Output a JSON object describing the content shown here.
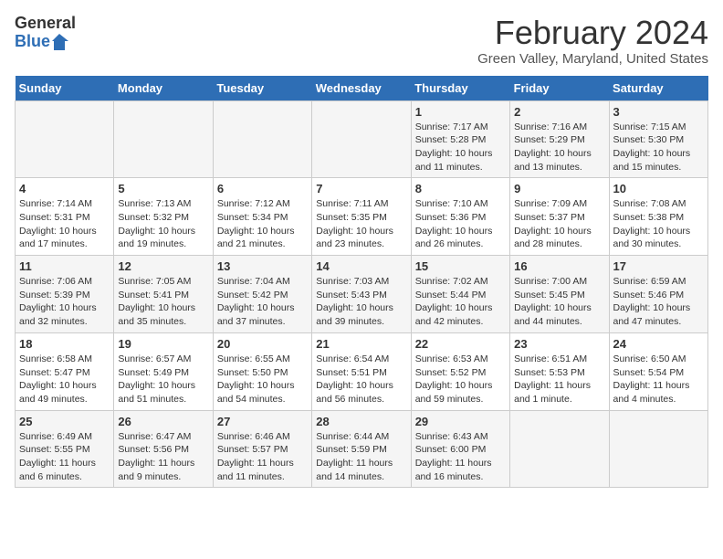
{
  "logo": {
    "line1": "General",
    "line2": "Blue"
  },
  "title": "February 2024",
  "subtitle": "Green Valley, Maryland, United States",
  "days_header": [
    "Sunday",
    "Monday",
    "Tuesday",
    "Wednesday",
    "Thursday",
    "Friday",
    "Saturday"
  ],
  "weeks": [
    [
      {
        "day": "",
        "info": ""
      },
      {
        "day": "",
        "info": ""
      },
      {
        "day": "",
        "info": ""
      },
      {
        "day": "",
        "info": ""
      },
      {
        "day": "1",
        "info": "Sunrise: 7:17 AM\nSunset: 5:28 PM\nDaylight: 10 hours\nand 11 minutes."
      },
      {
        "day": "2",
        "info": "Sunrise: 7:16 AM\nSunset: 5:29 PM\nDaylight: 10 hours\nand 13 minutes."
      },
      {
        "day": "3",
        "info": "Sunrise: 7:15 AM\nSunset: 5:30 PM\nDaylight: 10 hours\nand 15 minutes."
      }
    ],
    [
      {
        "day": "4",
        "info": "Sunrise: 7:14 AM\nSunset: 5:31 PM\nDaylight: 10 hours\nand 17 minutes."
      },
      {
        "day": "5",
        "info": "Sunrise: 7:13 AM\nSunset: 5:32 PM\nDaylight: 10 hours\nand 19 minutes."
      },
      {
        "day": "6",
        "info": "Sunrise: 7:12 AM\nSunset: 5:34 PM\nDaylight: 10 hours\nand 21 minutes."
      },
      {
        "day": "7",
        "info": "Sunrise: 7:11 AM\nSunset: 5:35 PM\nDaylight: 10 hours\nand 23 minutes."
      },
      {
        "day": "8",
        "info": "Sunrise: 7:10 AM\nSunset: 5:36 PM\nDaylight: 10 hours\nand 26 minutes."
      },
      {
        "day": "9",
        "info": "Sunrise: 7:09 AM\nSunset: 5:37 PM\nDaylight: 10 hours\nand 28 minutes."
      },
      {
        "day": "10",
        "info": "Sunrise: 7:08 AM\nSunset: 5:38 PM\nDaylight: 10 hours\nand 30 minutes."
      }
    ],
    [
      {
        "day": "11",
        "info": "Sunrise: 7:06 AM\nSunset: 5:39 PM\nDaylight: 10 hours\nand 32 minutes."
      },
      {
        "day": "12",
        "info": "Sunrise: 7:05 AM\nSunset: 5:41 PM\nDaylight: 10 hours\nand 35 minutes."
      },
      {
        "day": "13",
        "info": "Sunrise: 7:04 AM\nSunset: 5:42 PM\nDaylight: 10 hours\nand 37 minutes."
      },
      {
        "day": "14",
        "info": "Sunrise: 7:03 AM\nSunset: 5:43 PM\nDaylight: 10 hours\nand 39 minutes."
      },
      {
        "day": "15",
        "info": "Sunrise: 7:02 AM\nSunset: 5:44 PM\nDaylight: 10 hours\nand 42 minutes."
      },
      {
        "day": "16",
        "info": "Sunrise: 7:00 AM\nSunset: 5:45 PM\nDaylight: 10 hours\nand 44 minutes."
      },
      {
        "day": "17",
        "info": "Sunrise: 6:59 AM\nSunset: 5:46 PM\nDaylight: 10 hours\nand 47 minutes."
      }
    ],
    [
      {
        "day": "18",
        "info": "Sunrise: 6:58 AM\nSunset: 5:47 PM\nDaylight: 10 hours\nand 49 minutes."
      },
      {
        "day": "19",
        "info": "Sunrise: 6:57 AM\nSunset: 5:49 PM\nDaylight: 10 hours\nand 51 minutes."
      },
      {
        "day": "20",
        "info": "Sunrise: 6:55 AM\nSunset: 5:50 PM\nDaylight: 10 hours\nand 54 minutes."
      },
      {
        "day": "21",
        "info": "Sunrise: 6:54 AM\nSunset: 5:51 PM\nDaylight: 10 hours\nand 56 minutes."
      },
      {
        "day": "22",
        "info": "Sunrise: 6:53 AM\nSunset: 5:52 PM\nDaylight: 10 hours\nand 59 minutes."
      },
      {
        "day": "23",
        "info": "Sunrise: 6:51 AM\nSunset: 5:53 PM\nDaylight: 11 hours\nand 1 minute."
      },
      {
        "day": "24",
        "info": "Sunrise: 6:50 AM\nSunset: 5:54 PM\nDaylight: 11 hours\nand 4 minutes."
      }
    ],
    [
      {
        "day": "25",
        "info": "Sunrise: 6:49 AM\nSunset: 5:55 PM\nDaylight: 11 hours\nand 6 minutes."
      },
      {
        "day": "26",
        "info": "Sunrise: 6:47 AM\nSunset: 5:56 PM\nDaylight: 11 hours\nand 9 minutes."
      },
      {
        "day": "27",
        "info": "Sunrise: 6:46 AM\nSunset: 5:57 PM\nDaylight: 11 hours\nand 11 minutes."
      },
      {
        "day": "28",
        "info": "Sunrise: 6:44 AM\nSunset: 5:59 PM\nDaylight: 11 hours\nand 14 minutes."
      },
      {
        "day": "29",
        "info": "Sunrise: 6:43 AM\nSunset: 6:00 PM\nDaylight: 11 hours\nand 16 minutes."
      },
      {
        "day": "",
        "info": ""
      },
      {
        "day": "",
        "info": ""
      }
    ]
  ]
}
